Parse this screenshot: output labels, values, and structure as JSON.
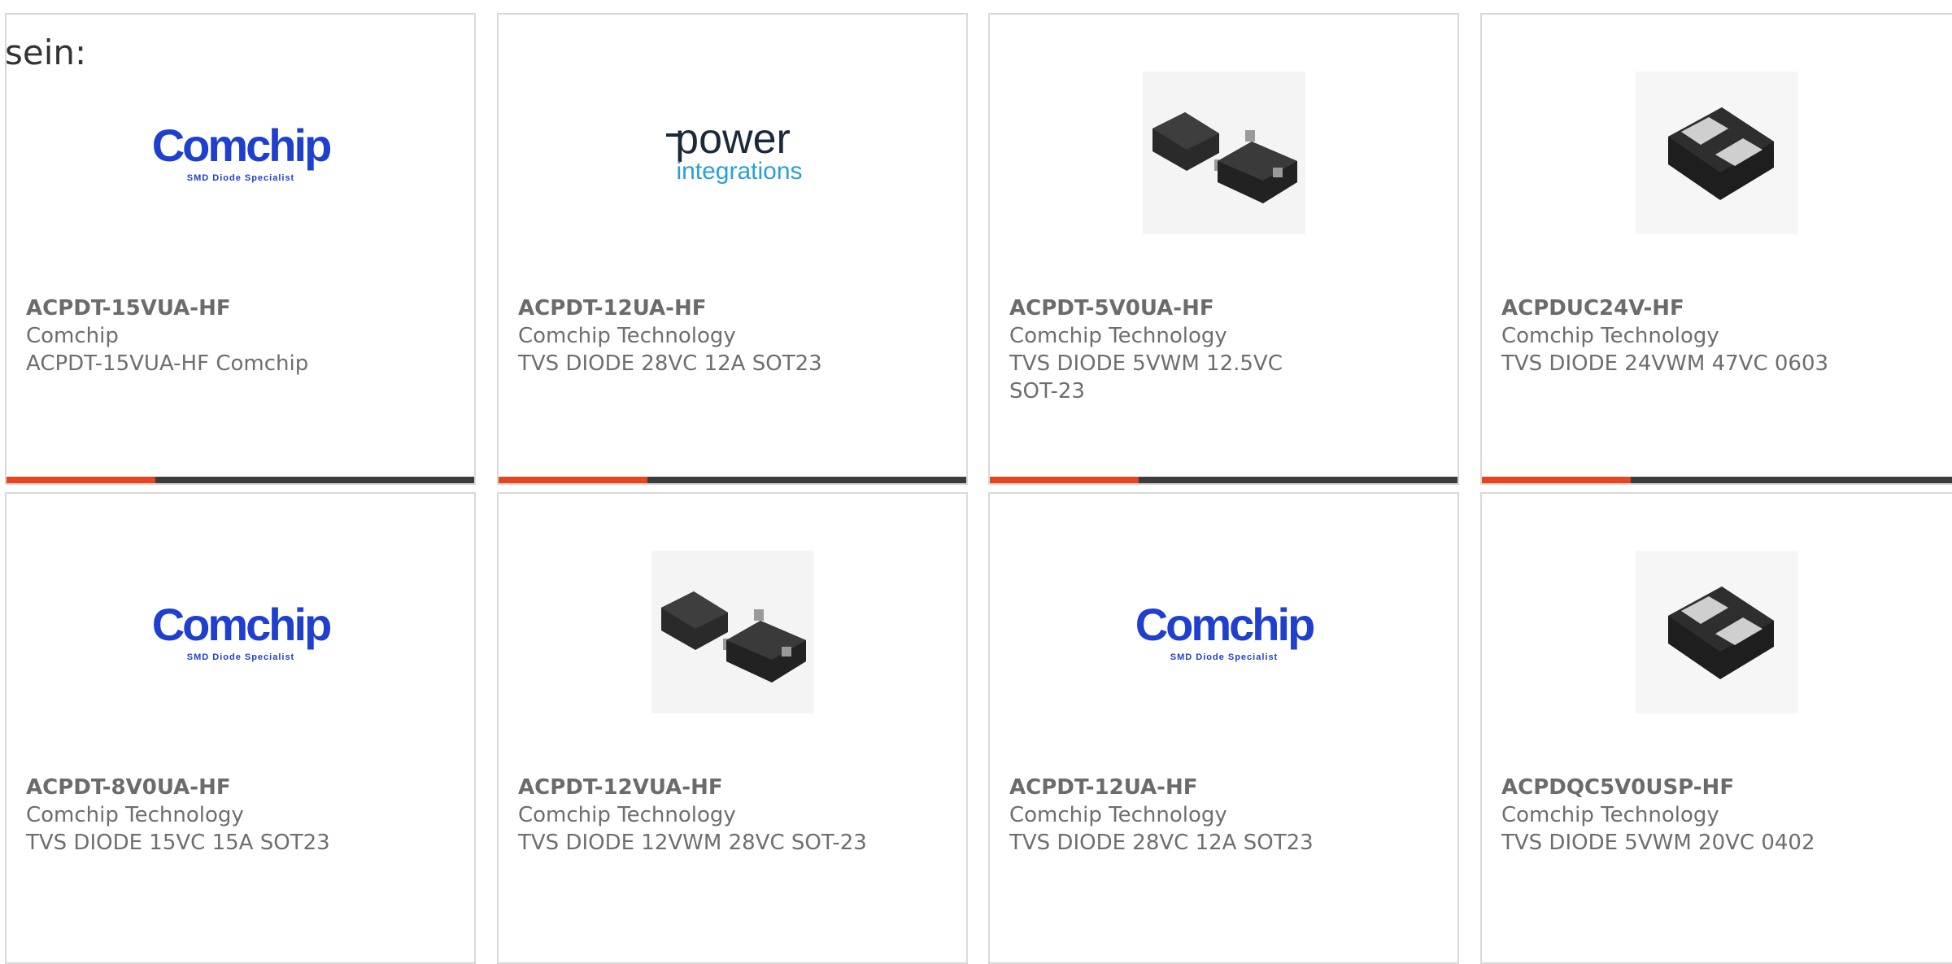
{
  "intro_text": "sein:",
  "brand_color": "#e8441e",
  "products": [
    {
      "part": "ACPDT-15VUA-HF",
      "manufacturer": "Comchip",
      "description": "ACPDT-15VUA-HF Comchip",
      "image": "comchip-logo",
      "logo_text": "Comchip",
      "logo_sub": "SMD Diode Specialist"
    },
    {
      "part": "ACPDT-12UA-HF",
      "manufacturer": "Comchip Technology",
      "description": "TVS DIODE 28VC 12A SOT23",
      "image": "power-integrations-logo",
      "logo_text": "power",
      "logo_sub": "integrations"
    },
    {
      "part": "ACPDT-5V0UA-HF",
      "manufacturer": "Comchip Technology",
      "description": "TVS DIODE 5VWM 12.5VC SOT-23",
      "image": "sot23-package"
    },
    {
      "part": "ACPDUC24V-HF",
      "manufacturer": "Comchip Technology",
      "description": "TVS DIODE 24VWM 47VC 0603",
      "image": "chip-package"
    },
    {
      "part": "ACPDT-8V0UA-HF",
      "manufacturer": "Comchip Technology",
      "description": "TVS DIODE 15VC 15A SOT23",
      "image": "comchip-logo",
      "logo_text": "Comchip",
      "logo_sub": "SMD Diode Specialist"
    },
    {
      "part": "ACPDT-12VUA-HF",
      "manufacturer": "Comchip Technology",
      "description": "TVS DIODE 12VWM 28VC SOT-23",
      "image": "sot23-package"
    },
    {
      "part": "ACPDT-12UA-HF",
      "manufacturer": "Comchip Technology",
      "description": "TVS DIODE 28VC 12A SOT23",
      "image": "comchip-logo",
      "logo_text": "Comchip",
      "logo_sub": "SMD Diode Specialist"
    },
    {
      "part": "ACPDQC5V0USP-HF",
      "manufacturer": "Comchip Technology",
      "description": "TVS DIODE 5VWM 20VC 0402",
      "image": "chip-package"
    }
  ]
}
